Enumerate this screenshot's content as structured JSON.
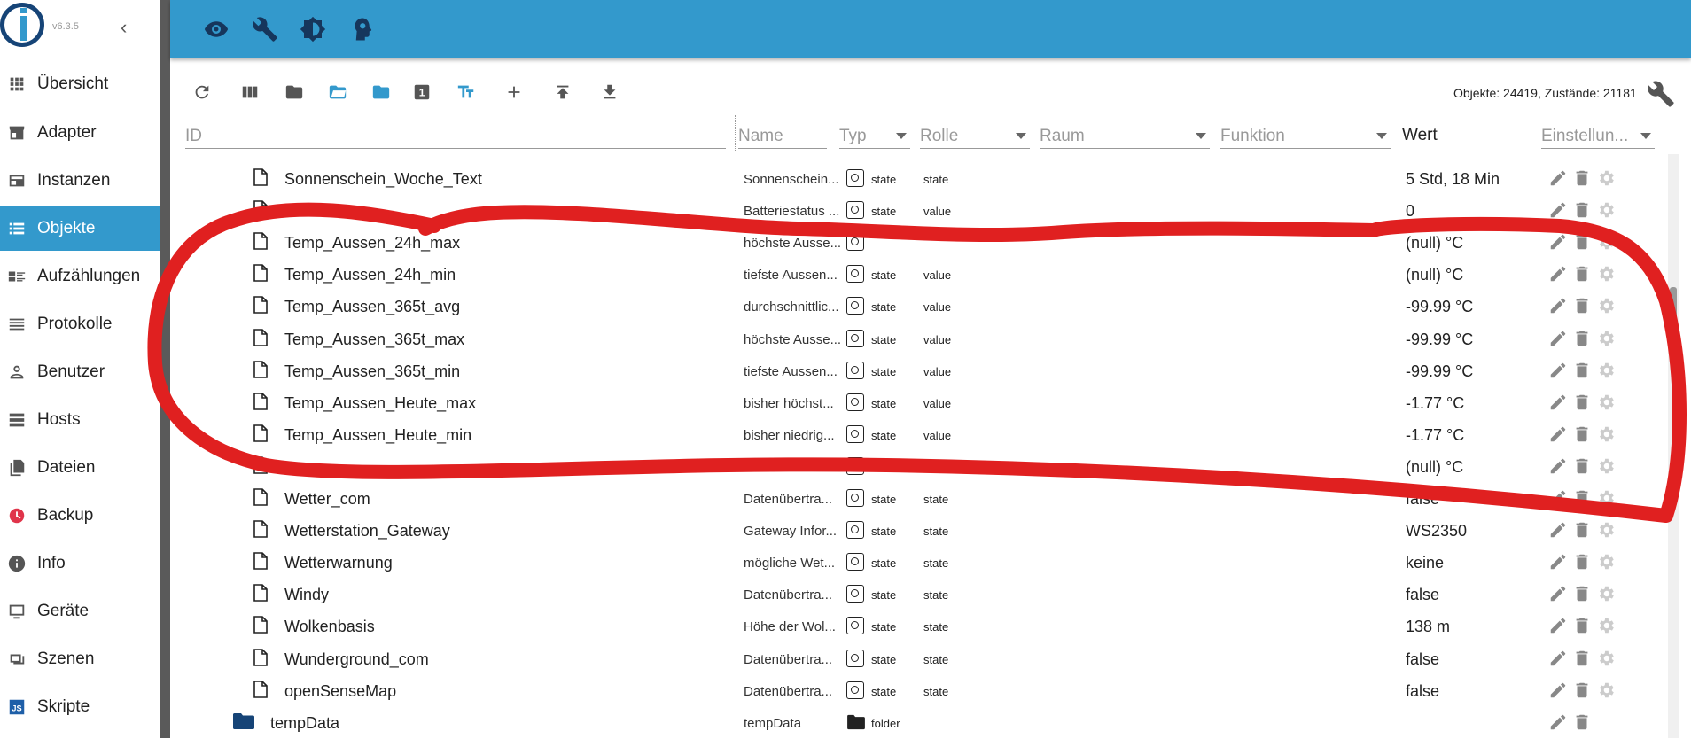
{
  "sidebar": {
    "version": "v6.3.5",
    "items": [
      {
        "label": "Übersicht",
        "icon": "grid-icon"
      },
      {
        "label": "Adapter",
        "icon": "store-icon"
      },
      {
        "label": "Instanzen",
        "icon": "instances-icon"
      },
      {
        "label": "Objekte",
        "icon": "list-icon",
        "active": true
      },
      {
        "label": "Aufzählungen",
        "icon": "enum-icon"
      },
      {
        "label": "Protokolle",
        "icon": "log-icon"
      },
      {
        "label": "Benutzer",
        "icon": "user-icon"
      },
      {
        "label": "Hosts",
        "icon": "hosts-icon"
      },
      {
        "label": "Dateien",
        "icon": "files-icon"
      },
      {
        "label": "Backup",
        "icon": "backup-icon"
      },
      {
        "label": "Info",
        "icon": "info-icon"
      },
      {
        "label": "Geräte",
        "icon": "devices-icon"
      },
      {
        "label": "Szenen",
        "icon": "scenes-icon"
      },
      {
        "label": "Skripte",
        "icon": "js-icon"
      }
    ]
  },
  "topbar": {
    "icons": [
      "eye-icon",
      "wrench-icon",
      "theme-icon",
      "expert-mode-icon"
    ]
  },
  "toolbar": {
    "counts": "Objekte: 24419, Zustände: 21181",
    "icons": [
      "refresh-icon",
      "columns-icon",
      "folder-icon",
      "folder-open-icon",
      "folder-blue-icon",
      "one-icon",
      "text-size-icon",
      "add-icon",
      "upload-icon",
      "download-icon"
    ]
  },
  "header": {
    "id_placeholder": "ID",
    "name_placeholder": "Name",
    "type_placeholder": "Typ",
    "role_placeholder": "Rolle",
    "room_placeholder": "Raum",
    "function_placeholder": "Funktion",
    "value_label": "Wert",
    "settings_placeholder": "Einstellun..."
  },
  "rows": [
    {
      "id": "Sonnenschein_Woche_Text",
      "name": "Sonnenschein...",
      "type": "state",
      "role": "state",
      "value": "5 Std, 18 Min"
    },
    {
      "id": "",
      "name": "Batteriestatus ...",
      "type": "state",
      "role": "value",
      "value": "0"
    },
    {
      "id": "Temp_Aussen_24h_max",
      "name": "höchste Ausse...",
      "type": "",
      "role": "",
      "value": "(null) °C"
    },
    {
      "id": "Temp_Aussen_24h_min",
      "name": "tiefste Aussen...",
      "type": "state",
      "role": "value",
      "value": "(null) °C"
    },
    {
      "id": "Temp_Aussen_365t_avg",
      "name": "durchschnittlic...",
      "type": "state",
      "role": "value",
      "value": "-99.99 °C"
    },
    {
      "id": "Temp_Aussen_365t_max",
      "name": "höchste Ausse...",
      "type": "state",
      "role": "value",
      "value": "-99.99 °C"
    },
    {
      "id": "Temp_Aussen_365t_min",
      "name": "tiefste Aussen...",
      "type": "state",
      "role": "value",
      "value": "-99.99 °C"
    },
    {
      "id": "Temp_Aussen_Heute_max",
      "name": "bisher höchst...",
      "type": "state",
      "role": "value",
      "value": "-1.77 °C"
    },
    {
      "id": "Temp_Aussen_Heute_min",
      "name": "bisher niedrig...",
      "type": "state",
      "role": "value",
      "value": "-1.77 °C"
    },
    {
      "id": "",
      "name": "",
      "type": "",
      "role": "value",
      "value": "(null) °C"
    },
    {
      "id": "Wetter_com",
      "name": "Datenübertra...",
      "type": "state",
      "role": "state",
      "value": "false"
    },
    {
      "id": "Wetterstation_Gateway",
      "name": "Gateway Infor...",
      "type": "state",
      "role": "state",
      "value": "WS2350"
    },
    {
      "id": "Wetterwarnung",
      "name": "mögliche Wet...",
      "type": "state",
      "role": "state",
      "value": "keine"
    },
    {
      "id": "Windy",
      "name": "Datenübertra...",
      "type": "state",
      "role": "state",
      "value": "false"
    },
    {
      "id": "Wolkenbasis",
      "name": "Höhe der Wol...",
      "type": "state",
      "role": "state",
      "value": "138 m"
    },
    {
      "id": "Wunderground_com",
      "name": "Datenübertra...",
      "type": "state",
      "role": "state",
      "value": "false"
    },
    {
      "id": "openSenseMap",
      "name": "Datenübertra...",
      "type": "state",
      "role": "state",
      "value": "false"
    }
  ],
  "folder_row": {
    "id": "tempData",
    "name": "tempData",
    "type": "folder"
  },
  "colors": {
    "accent": "#3399cc",
    "annotation": "#e02020"
  }
}
